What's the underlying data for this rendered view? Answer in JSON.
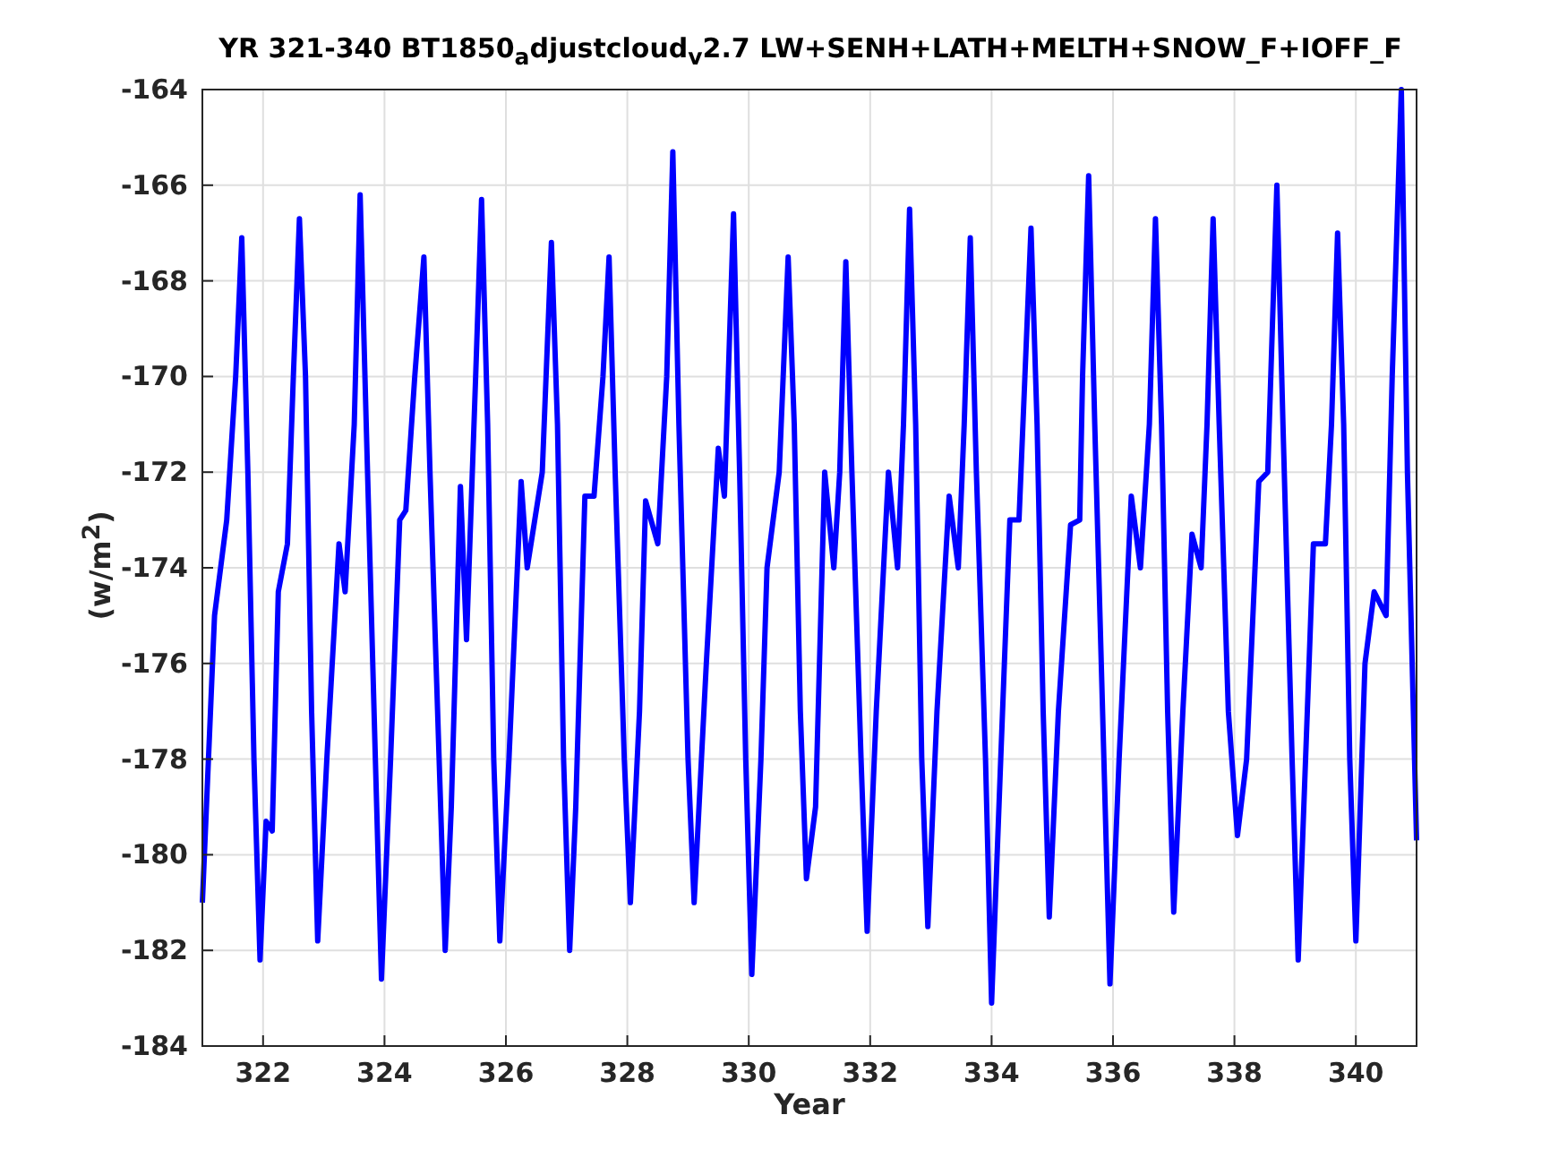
{
  "figure": {
    "chart_data": {
      "type": "line",
      "title": "YR 321-340 BT1850$_{a}$djustcloud$_{v}$2.7 LW+SENH+LATH+MELTH+SNOW_F+IOFF_F",
      "xlabel": "Year",
      "ylabel": "(w/m$^{2}$)",
      "x": [
        321.0,
        321.2,
        321.4,
        321.55,
        321.65,
        321.75,
        321.85,
        321.95,
        322.05,
        322.15,
        322.25,
        322.4,
        322.5,
        322.6,
        322.7,
        322.8,
        322.9,
        323.05,
        323.25,
        323.35,
        323.5,
        323.6,
        323.7,
        323.85,
        323.95,
        324.1,
        324.25,
        324.35,
        324.5,
        324.65,
        324.75,
        324.9,
        325.0,
        325.1,
        325.25,
        325.35,
        325.5,
        325.6,
        325.7,
        325.8,
        325.9,
        326.05,
        326.25,
        326.35,
        326.6,
        326.75,
        326.85,
        326.95,
        327.05,
        327.15,
        327.3,
        327.45,
        327.6,
        327.7,
        327.8,
        327.95,
        328.05,
        328.2,
        328.3,
        328.5,
        328.65,
        328.75,
        328.85,
        329.0,
        329.1,
        329.3,
        329.5,
        329.6,
        329.75,
        329.85,
        329.95,
        330.05,
        330.2,
        330.3,
        330.5,
        330.65,
        330.75,
        330.85,
        330.95,
        331.1,
        331.25,
        331.4,
        331.5,
        331.6,
        331.7,
        331.85,
        331.95,
        332.1,
        332.3,
        332.45,
        332.55,
        332.65,
        332.75,
        332.85,
        332.95,
        333.1,
        333.3,
        333.45,
        333.55,
        333.65,
        333.75,
        333.9,
        334.0,
        334.15,
        334.3,
        334.45,
        334.55,
        334.65,
        334.75,
        334.85,
        334.95,
        335.1,
        335.3,
        335.45,
        335.5,
        335.6,
        335.7,
        335.85,
        335.95,
        336.1,
        336.3,
        336.45,
        336.6,
        336.7,
        336.8,
        336.9,
        337.0,
        337.15,
        337.3,
        337.45,
        337.55,
        337.65,
        337.75,
        337.9,
        338.05,
        338.2,
        338.4,
        338.55,
        338.7,
        338.8,
        338.95,
        339.05,
        339.2,
        339.3,
        339.5,
        339.6,
        339.7,
        339.8,
        339.9,
        340.0,
        340.15,
        340.3,
        340.5,
        340.6,
        340.75,
        340.85,
        341.0
      ],
      "series": [
        {
          "color": "#0000ff",
          "values": [
            -181.0,
            -175,
            -173,
            -170,
            -167.1,
            -172,
            -178,
            -182.2,
            -179.3,
            -179.5,
            -174.5,
            -173.5,
            -170,
            -166.7,
            -170,
            -177,
            -181.8,
            -178,
            -173.5,
            -174.5,
            -171,
            -166.2,
            -171,
            -178,
            -182.6,
            -178,
            -173,
            -172.8,
            -170,
            -167.5,
            -172,
            -178,
            -182,
            -179,
            -172.3,
            -175.5,
            -170,
            -166.3,
            -171,
            -178,
            -181.8,
            -178,
            -172.2,
            -174,
            -172,
            -167.2,
            -171,
            -178,
            -182,
            -179,
            -172.5,
            -172.5,
            -170,
            -167.5,
            -172,
            -178,
            -181,
            -177,
            -172.6,
            -173.5,
            -170,
            -165.3,
            -171,
            -178,
            -181,
            -176,
            -171.5,
            -172.5,
            -166.6,
            -172,
            -178,
            -182.5,
            -178,
            -174,
            -172,
            -167.5,
            -171,
            -177,
            -180.5,
            -179,
            -172,
            -174,
            -172,
            -167.6,
            -172,
            -178,
            -181.6,
            -177,
            -172,
            -174,
            -171,
            -166.5,
            -171,
            -178,
            -181.5,
            -177,
            -172.5,
            -174,
            -171,
            -167.1,
            -172,
            -178,
            -183.1,
            -178,
            -173,
            -173,
            -170,
            -166.9,
            -171,
            -177,
            -181.3,
            -177,
            -173.1,
            -173,
            -170,
            -165.8,
            -171,
            -178,
            -182.7,
            -178,
            -172.5,
            -174,
            -171,
            -166.7,
            -171,
            -177,
            -181.2,
            -177,
            -173.3,
            -174,
            -171,
            -166.7,
            -171,
            -177,
            -179.6,
            -178,
            -172.2,
            -172,
            -166,
            -171,
            -178,
            -182.2,
            -177,
            -173.5,
            -173.5,
            -171,
            -167,
            -171,
            -178,
            -181.8,
            -176,
            -174.5,
            -175,
            -170,
            -164,
            -172,
            -179.7
          ]
        }
      ],
      "grid": true,
      "xlim": [
        321,
        341
      ],
      "ylim": [
        -184,
        -164
      ],
      "xticks": [
        322,
        324,
        326,
        328,
        330,
        332,
        334,
        336,
        338,
        340
      ],
      "yticks": [
        -184,
        -182,
        -180,
        -178,
        -176,
        -174,
        -172,
        -170,
        -168,
        -166,
        -164
      ]
    }
  }
}
